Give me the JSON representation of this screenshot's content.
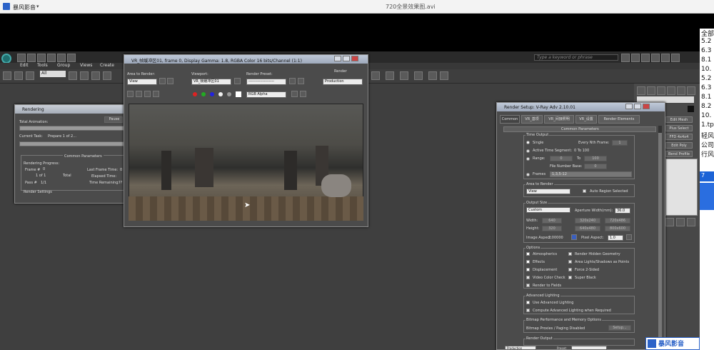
{
  "player": {
    "app_name": "暴风影音",
    "video_title": "720全景效果图.avi"
  },
  "max": {
    "menus": [
      "Edit",
      "Tools",
      "Group",
      "Views",
      "Create"
    ],
    "selection_filter": "All",
    "search_placeholder": "Type a keyword or phrase",
    "cmd_buttons": [
      "Edit Mesh",
      "Plus Select",
      "FFD 4x4x4",
      "Edit Poly",
      "Bend Profile"
    ]
  },
  "rendering": {
    "title": "Rendering",
    "pause_label": "Pause",
    "total_animation": "Total Animation:",
    "current_task": "Current Task:",
    "current_task_value": "Prepare 1 of 2...",
    "common_parameters": "Common Parameters",
    "rendering_progress": "Rendering Progress:",
    "frame_label": "Frame #",
    "frame_value": "0",
    "frame_count": "1 of 1",
    "total_label": "Total",
    "pass_label": "Pass #",
    "pass_value": "1/1",
    "last_frame_time": "Last Frame Time:",
    "last_frame_value": "0",
    "elapsed_time": "Elapsed Time:",
    "time_remaining": "Time Remaining:",
    "time_remaining_value": "??",
    "render_settings": "Render Settings"
  },
  "vfb": {
    "title": "VR_帧缓冲区01, frame 0, Display Gamma: 1.8, RGBA Color 16 bits/Channel (1:1)",
    "area_label": "Area to Render:",
    "area_value": "View",
    "viewport_label": "Viewport:",
    "viewport_value": "VR_帧缓冲区01",
    "preset_label": "Render Preset:",
    "preset_value": "--------------------",
    "render_label": "Render",
    "render_value": "Production",
    "channel_value": "RGB Alpha"
  },
  "setup": {
    "title": "Render Setup: V-Ray Adv 2.10.01",
    "tabs": [
      "Common",
      "VR_基项",
      "VR_间接照明",
      "VR_设置",
      "Render Elements"
    ],
    "common_parameters": "Common Parameters",
    "time_output": "Time Output",
    "single": "Single",
    "every_nth": "Every Nth Frame:",
    "every_nth_value": "1",
    "active_segment": "Active Time Segment:",
    "active_segment_value": "0 To 100",
    "range": "Range:",
    "range_from": "0",
    "range_to_label": "To",
    "range_to": "100",
    "file_number_base": "File Number Base:",
    "file_number_value": "0",
    "frames": "Frames",
    "frames_value": "1,3,5-12",
    "area_to_render": "Area to Render",
    "area_value": "View",
    "auto_region": "Auto Region Selected",
    "output_size": "Output Size",
    "output_preset": "Custom",
    "aperture_label": "Aperture Width(mm):",
    "aperture_value": "36.0",
    "width_label": "Width:",
    "width_value": "640",
    "height_label": "Height:",
    "height_value": "320",
    "presets": [
      "320x240",
      "720x486",
      "640x480",
      "800x600"
    ],
    "image_aspect_label": "Image Aspect:",
    "image_aspect_value": "2.00000",
    "pixel_aspect_label": "Pixel Aspect:",
    "pixel_aspect_value": "1.0",
    "options": "Options",
    "atmospherics": "Atmospherics",
    "render_hidden": "Render Hidden Geometry",
    "effects": "Effects",
    "area_lights": "Area Lights/Shadows as Points",
    "displacement": "Displacement",
    "force_2sided": "Force 2-Sided",
    "video_color": "Video Color Check",
    "super_black": "Super Black",
    "render_fields": "Render to Fields",
    "advanced_lighting": "Advanced Lighting",
    "use_adv_lighting": "Use Advanced Lighting",
    "compute_adv": "Compute Advanced Lighting when Required",
    "bitmap_perf": "Bitmap Performance and Memory Options",
    "bitmap_proxies": "Bitmap Proxies / Paging Disabled",
    "setup_button": "Setup...",
    "render_output": "Render Output",
    "production": "Production",
    "preset": "Preset:"
  },
  "side_list": [
    "全部",
    "5.2",
    "6.3",
    "8.1",
    "10.",
    "5.2",
    "6.3",
    "8.1",
    "8.2",
    "10.",
    "1.tp",
    "轻风",
    "公司",
    "行风",
    "7"
  ],
  "watermark": "暴风影音"
}
